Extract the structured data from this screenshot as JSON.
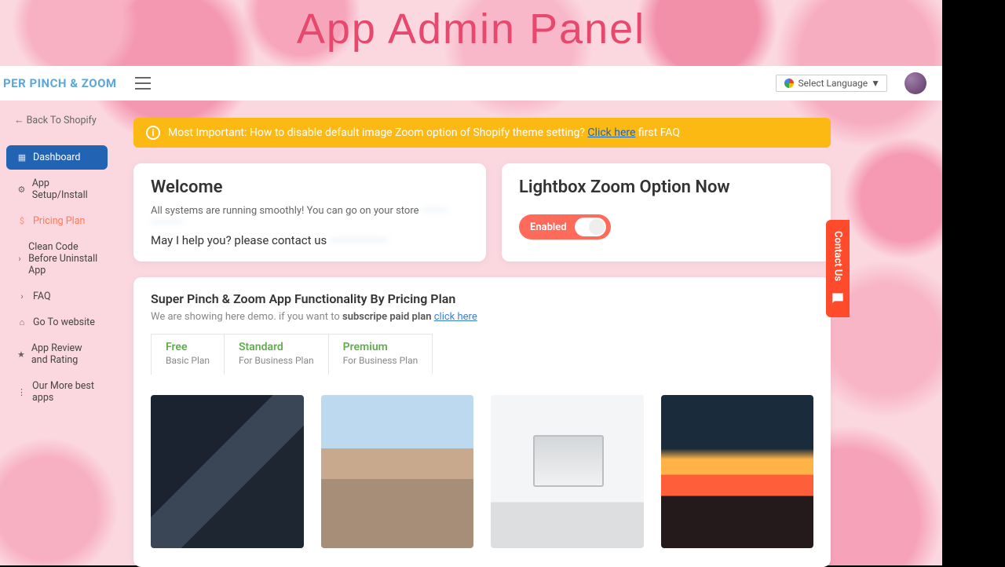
{
  "page": {
    "title": "App Admin Panel"
  },
  "brand": "PER PINCH & ZOOM",
  "lang": "Select Language",
  "sidebar": {
    "back": "Back To Shopify",
    "items": [
      {
        "label": "Dashboard",
        "active": true
      },
      {
        "label": "App Setup/Install"
      },
      {
        "label": "Pricing Plan",
        "accent": true
      },
      {
        "label": "Clean Code Before Uninstall App"
      },
      {
        "label": "FAQ"
      },
      {
        "label": "Go To website"
      },
      {
        "label": "App Review and Rating"
      },
      {
        "label": "Our More best apps"
      }
    ]
  },
  "alert": {
    "prefix": "Most Important: How to disable default image Zoom option of Shopify theme setting?",
    "link": "Click here",
    "suffix": "first FAQ"
  },
  "welcome": {
    "title": "Welcome",
    "sub_a": "All systems are running smoothly! You can go on your store",
    "sub_blur": "·········· ············",
    "help": "May I help you? please contact us",
    "help_blur": "···················"
  },
  "lightbox": {
    "title": "Lightbox Zoom Option Now",
    "toggle": "Enabled"
  },
  "func": {
    "title": "Super Pinch & Zoom App Functionality By Pricing Plan",
    "desc_a": "We are showing here demo. if you want to ",
    "desc_b": "subscripe paid plan",
    "desc_link": "click here",
    "tabs": [
      {
        "name": "Free",
        "sub": "Basic Plan"
      },
      {
        "name": "Standard",
        "sub": "For Business Plan"
      },
      {
        "name": "Premium",
        "sub": "For Business Plan"
      }
    ]
  },
  "contact": "Contact Us"
}
